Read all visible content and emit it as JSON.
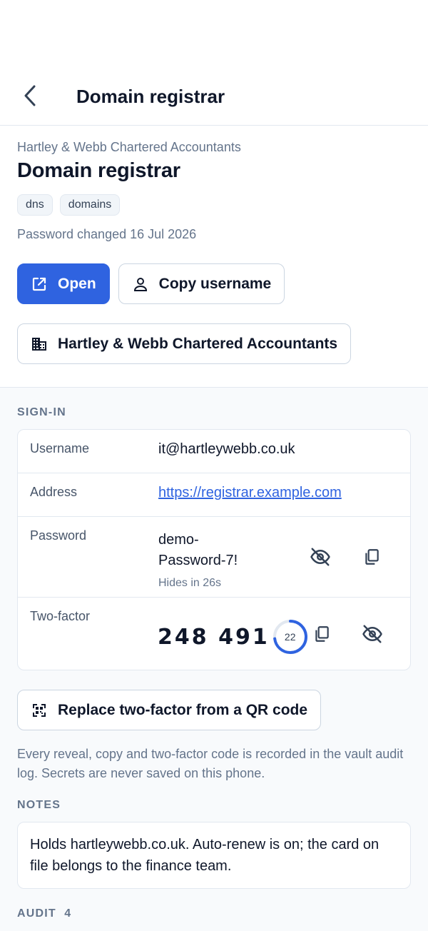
{
  "appbar": {
    "title": "Domain registrar"
  },
  "header": {
    "organization": "Hartley & Webb Chartered Accountants",
    "title": "Domain registrar",
    "tags": [
      "dns",
      "domains"
    ],
    "password_changed": "Password changed 16 Jul 2026"
  },
  "actions": {
    "open_label": "Open",
    "copy_username_label": "Copy username",
    "organization_label": "Hartley & Webb Chartered Accountants"
  },
  "signin": {
    "section_label": "SIGN-IN",
    "username_label": "Username",
    "username_value": "it@hartleywebb.co.uk",
    "address_label": "Address",
    "address_value": "https://registrar.example.com",
    "password_label": "Password",
    "password_value_line1": "demo-",
    "password_value_line2": "Password-7!",
    "password_hint": "Hides in 26s",
    "twofactor_label": "Two-factor",
    "twofactor_code": "248 491",
    "twofactor_seconds": "22",
    "twofactor_progress": 0.73
  },
  "qr": {
    "label": "Replace two-factor from a QR code"
  },
  "audit_note": "Every reveal, copy and two-factor code is recorded in the vault audit log. Secrets are never saved on this phone.",
  "notes": {
    "section_label": "NOTES",
    "text": "Holds hartleywebb.co.uk. Auto-renew is on; the card on file belongs to the finance team."
  },
  "audit": {
    "section_label": "AUDIT",
    "count": "4"
  },
  "colors": {
    "accent": "#2f63e0",
    "muted": "#64748b",
    "border": "#e2e8f0"
  }
}
